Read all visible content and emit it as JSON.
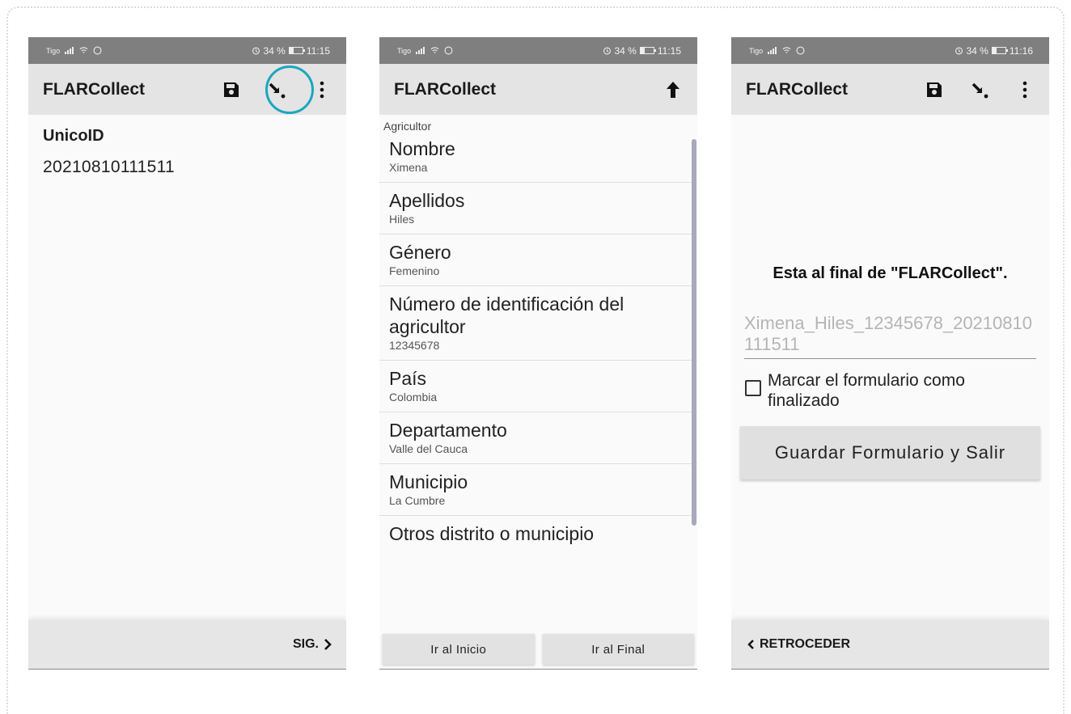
{
  "screens": [
    {
      "status": {
        "carrier": "Tigo",
        "battery": "34 %",
        "time": "11:15"
      },
      "appbar": {
        "title": "FLARCollect",
        "icons": [
          "save-icon",
          "jump-to-end-icon",
          "more-vert-icon"
        ]
      },
      "field": {
        "label": "UnicoID",
        "value": "20210810111511"
      },
      "bottom": {
        "next_label": "SIG."
      }
    },
    {
      "status": {
        "carrier": "Tigo",
        "battery": "34 %",
        "time": "11:15"
      },
      "appbar": {
        "title": "FLARCollect",
        "icons": [
          "up-arrow-icon"
        ]
      },
      "section": "Agricultor",
      "items": [
        {
          "question": "Nombre",
          "answer": "Ximena"
        },
        {
          "question": "Apellidos",
          "answer": "Hiles"
        },
        {
          "question": "Género",
          "answer": "Femenino"
        },
        {
          "question": "Número de identificación del agricultor",
          "answer": "12345678"
        },
        {
          "question": "País",
          "answer": "Colombia"
        },
        {
          "question": "Departamento",
          "answer": "Valle del Cauca"
        },
        {
          "question": "Municipio",
          "answer": "La Cumbre"
        },
        {
          "question": "Otros distrito o municipio",
          "answer": ""
        }
      ],
      "buttons": {
        "start": "Ir al Inicio",
        "end": "Ir al Final"
      }
    },
    {
      "status": {
        "carrier": "Tigo",
        "battery": "34 %",
        "time": "11:16"
      },
      "appbar": {
        "title": "FLARCollect",
        "icons": [
          "save-icon",
          "jump-to-end-icon",
          "more-vert-icon"
        ]
      },
      "heading": "Esta al final de \"FLARCollect\".",
      "form_name_value": "Ximena_Hiles_12345678_20210810111511",
      "checkbox_label": "Marcar el formulario como finalizado",
      "checkbox_checked": false,
      "save_button": "Guardar Formulario y Salir",
      "bottom": {
        "back_label": "RETROCEDER"
      }
    }
  ],
  "colors": {
    "appbar": "#e4e4e4",
    "statusbar": "#7f7f7f",
    "highlight_ring": "#1aa6bf",
    "scrollbar": "#a8a8bd"
  }
}
